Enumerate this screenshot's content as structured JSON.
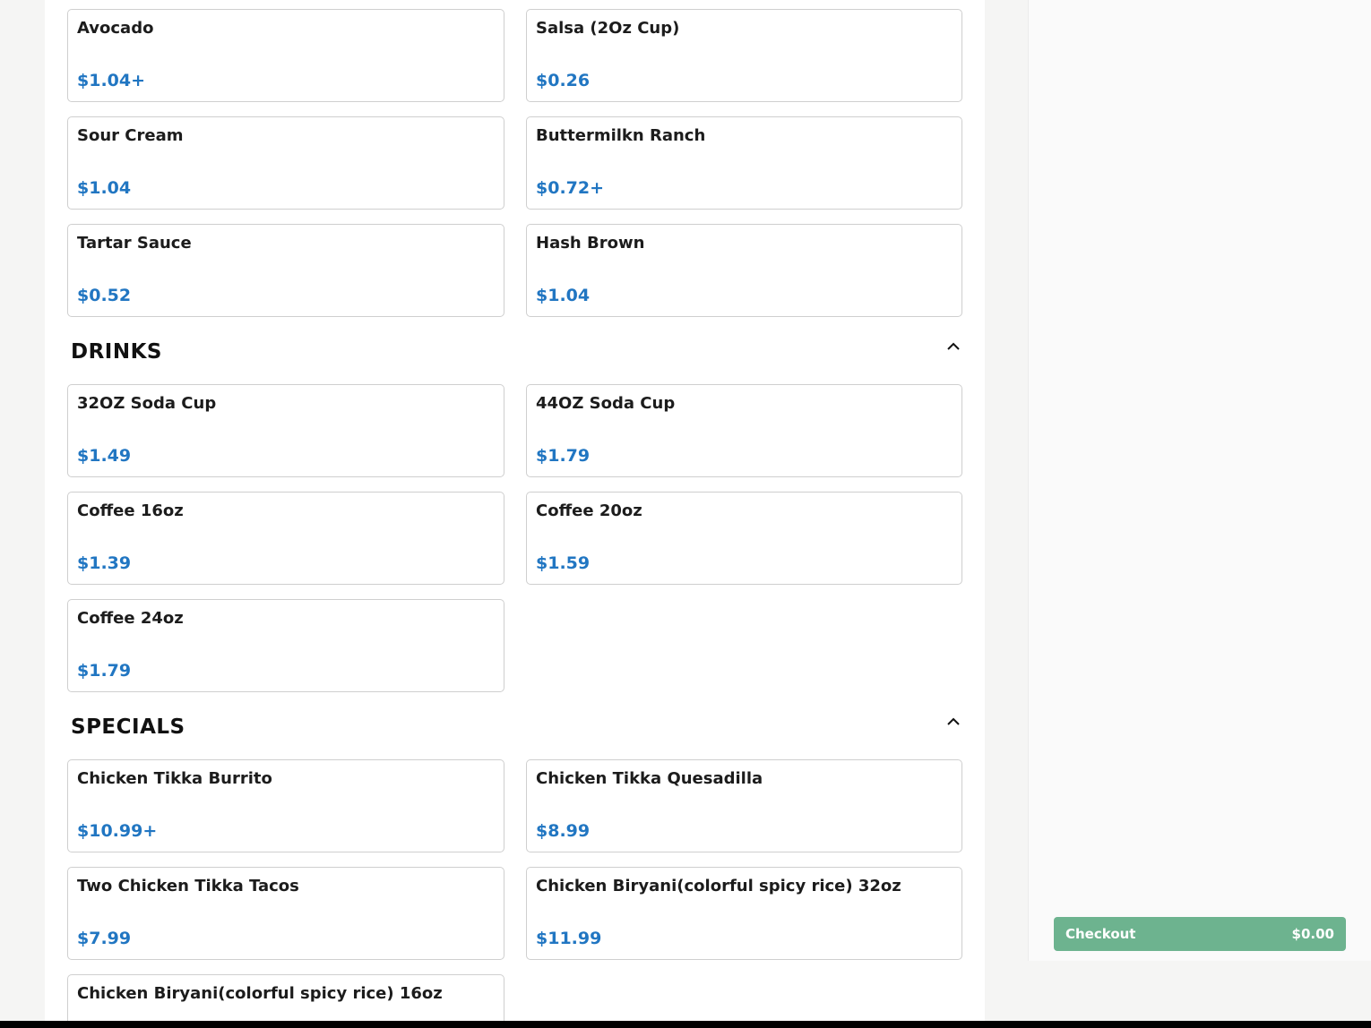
{
  "sections": [
    {
      "title": "",
      "items": [
        {
          "name": "Avocado",
          "price": "$1.04+"
        },
        {
          "name": "Salsa (2Oz Cup)",
          "price": "$0.26"
        },
        {
          "name": "Sour Cream",
          "price": "$1.04"
        },
        {
          "name": "Buttermilkn Ranch",
          "price": "$0.72+"
        },
        {
          "name": "Tartar Sauce",
          "price": "$0.52"
        },
        {
          "name": "Hash Brown",
          "price": "$1.04"
        }
      ]
    },
    {
      "title": "DRINKS",
      "items": [
        {
          "name": "32OZ Soda Cup",
          "price": "$1.49"
        },
        {
          "name": "44OZ Soda Cup",
          "price": "$1.79"
        },
        {
          "name": "Coffee 16oz",
          "price": "$1.39"
        },
        {
          "name": "Coffee 20oz",
          "price": "$1.59"
        },
        {
          "name": "Coffee 24oz",
          "price": "$1.79"
        }
      ]
    },
    {
      "title": "SPECIALS",
      "items": [
        {
          "name": "Chicken Tikka Burrito",
          "price": "$10.99+"
        },
        {
          "name": "Chicken Tikka Quesadilla",
          "price": "$8.99"
        },
        {
          "name": "Two Chicken Tikka Tacos",
          "price": "$7.99"
        },
        {
          "name": "Chicken Biryani(colorful spicy rice) 32oz",
          "price": "$11.99"
        },
        {
          "name": "Chicken Biryani(colorful spicy rice) 16oz",
          "price": ""
        }
      ]
    }
  ],
  "checkout": {
    "label": "Checkout",
    "total": "$0.00"
  },
  "icons": {
    "collapse": "chevron-up-icon"
  },
  "colors": {
    "price": "#2176c2",
    "checkout": "#6db38f"
  }
}
